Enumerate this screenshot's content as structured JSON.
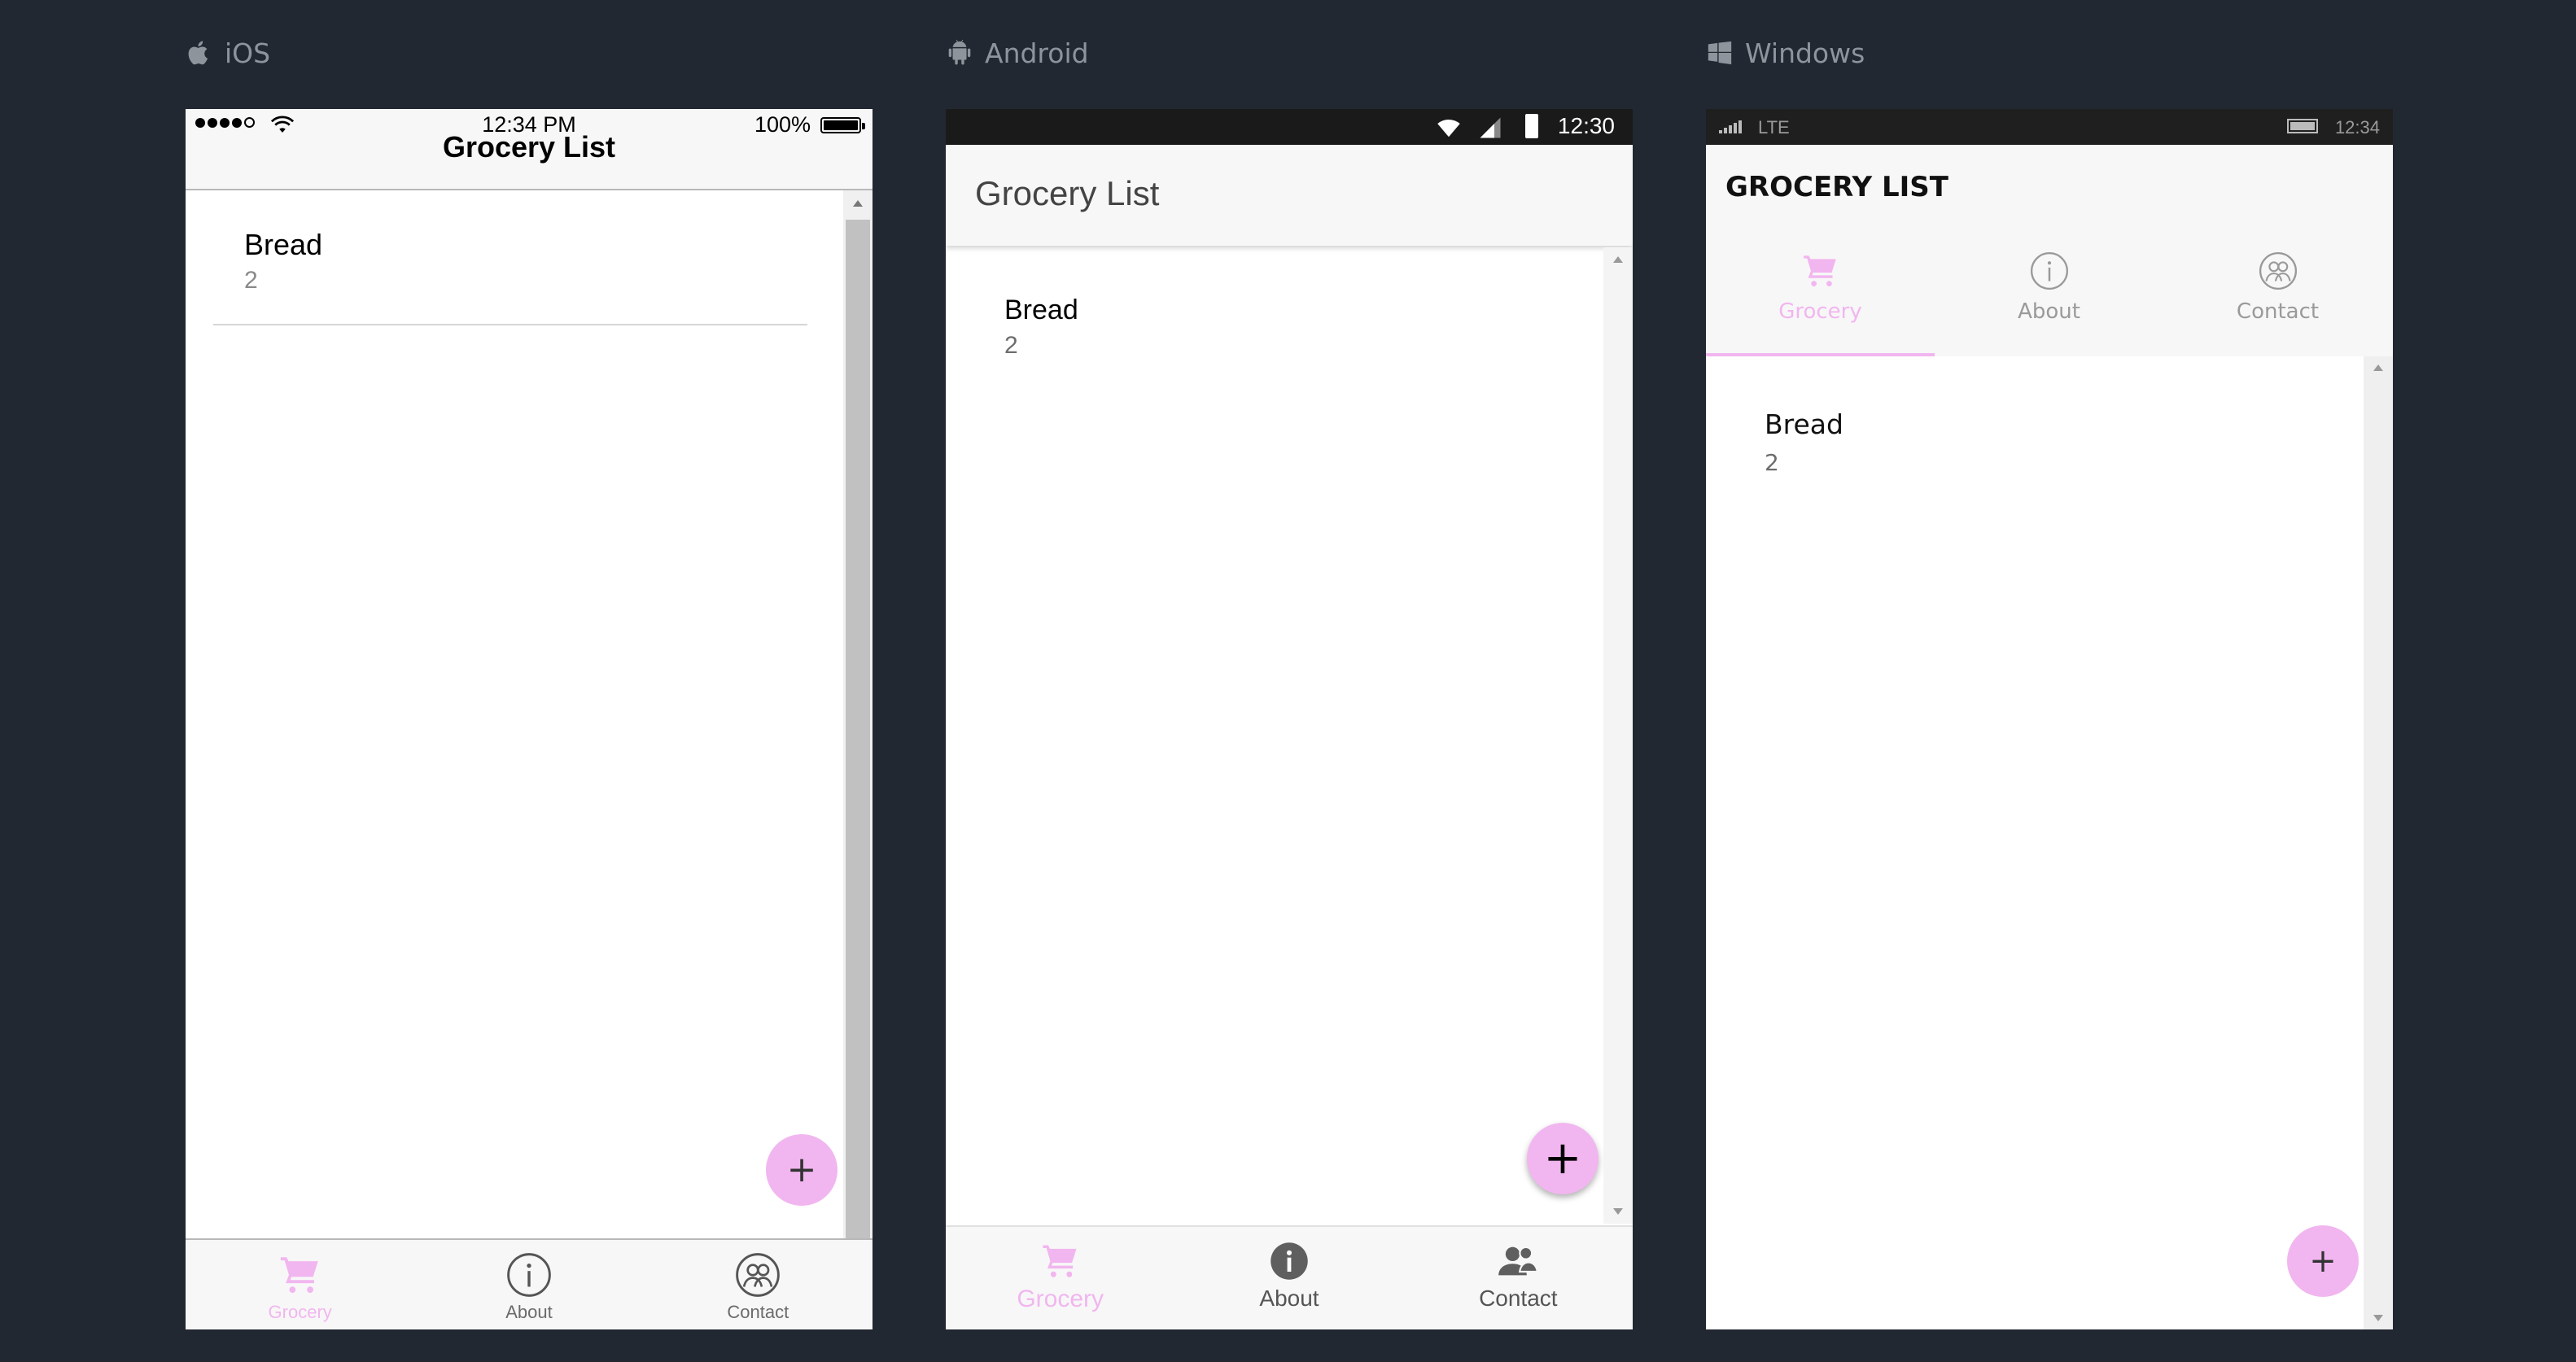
{
  "colors": {
    "background": "#222831",
    "accent": "#f1b6ef",
    "label": "#8e949c"
  },
  "platforms": {
    "ios": {
      "label": "iOS",
      "icon": "apple-icon"
    },
    "android": {
      "label": "Android",
      "icon": "android-icon"
    },
    "windows": {
      "label": "Windows",
      "icon": "windows-icon"
    }
  },
  "ios": {
    "status": {
      "time": "12:34 PM",
      "battery": "100%"
    },
    "title": "Grocery List",
    "items": [
      {
        "name": "Bread",
        "quantity": "2"
      }
    ],
    "fab": "+",
    "tabs": [
      {
        "label": "Grocery",
        "icon": "cart-icon",
        "active": true
      },
      {
        "label": "About",
        "icon": "info-icon",
        "active": false
      },
      {
        "label": "Contact",
        "icon": "contacts-icon",
        "active": false
      }
    ]
  },
  "android": {
    "status": {
      "time": "12:30"
    },
    "title": "Grocery List",
    "items": [
      {
        "name": "Bread",
        "quantity": "2"
      }
    ],
    "fab": "+",
    "tabs": [
      {
        "label": "Grocery",
        "icon": "cart-icon",
        "active": true
      },
      {
        "label": "About",
        "icon": "info-icon",
        "active": false
      },
      {
        "label": "Contact",
        "icon": "contacts-icon",
        "active": false
      }
    ]
  },
  "windows": {
    "status": {
      "network": "LTE",
      "time": "12:34"
    },
    "title": "GROCERY LIST",
    "items": [
      {
        "name": "Bread",
        "quantity": "2"
      }
    ],
    "fab": "+",
    "tabs": [
      {
        "label": "Grocery",
        "icon": "cart-icon",
        "active": true
      },
      {
        "label": "About",
        "icon": "info-icon",
        "active": false
      },
      {
        "label": "Contact",
        "icon": "contacts-icon",
        "active": false
      }
    ]
  }
}
